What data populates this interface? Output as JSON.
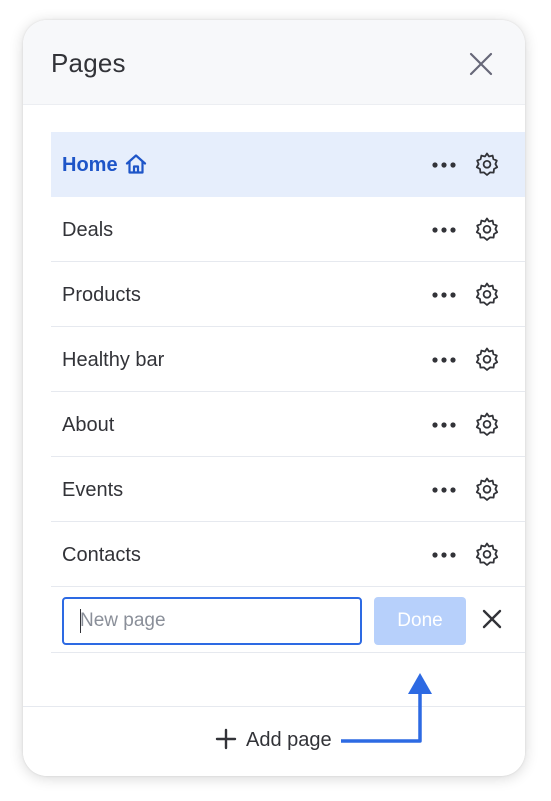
{
  "header": {
    "title": "Pages",
    "close_icon": "close-icon"
  },
  "pages": [
    {
      "label": "Home",
      "active": true,
      "home": true
    },
    {
      "label": "Deals",
      "active": false
    },
    {
      "label": "Products",
      "active": false
    },
    {
      "label": "Healthy bar",
      "active": false
    },
    {
      "label": "About",
      "active": false
    },
    {
      "label": "Events",
      "active": false
    },
    {
      "label": "Contacts",
      "active": false
    }
  ],
  "new_page": {
    "placeholder": "New page",
    "value": "",
    "done_label": "Done",
    "cancel_icon": "close-icon"
  },
  "footer": {
    "add_label": "Add page",
    "add_icon": "plus-icon"
  },
  "colors": {
    "accent": "#2d6ae3",
    "active_bg": "#e6eefc",
    "active_text": "#1e55c8",
    "done_disabled": "#b7d0fb",
    "text": "#323338"
  }
}
